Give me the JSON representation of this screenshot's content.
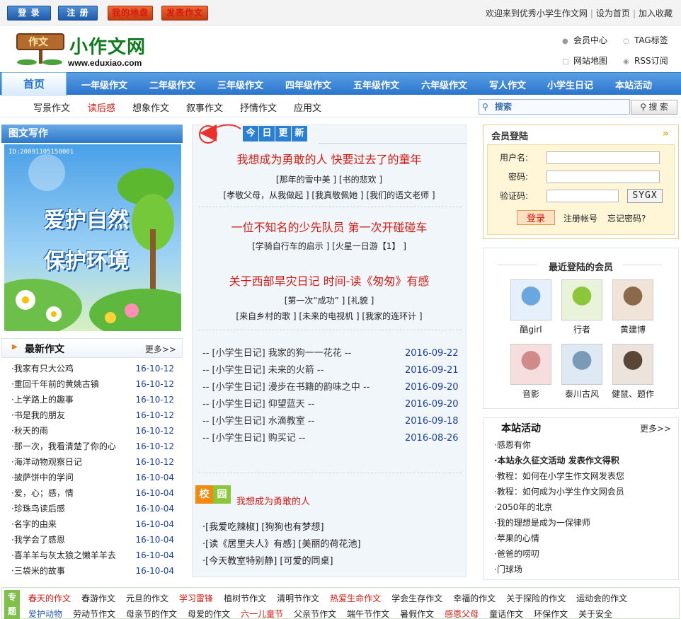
{
  "top": {
    "login": "登 录",
    "register": "注 册",
    "my_disk": "我的地盘",
    "post_essay": "发表作文",
    "welcome": "欢迎来到优秀小学生作文网",
    "set_home": "设为首页",
    "add_fav": "加入收藏"
  },
  "header": {
    "sign": "作文",
    "site_name": "小作文网",
    "url": "www.eduxiao.com",
    "links": [
      "会员中心",
      "TAG标签",
      "网站地图",
      "RSS订阅"
    ]
  },
  "nav": {
    "home": "首页",
    "items": [
      "一年级作文",
      "二年级作文",
      "三年级作文",
      "四年级作文",
      "五年级作文",
      "六年级作文",
      "写人作文",
      "小学生日记",
      "本站活动"
    ]
  },
  "subnav": [
    "写景作文",
    "读后感",
    "想象作文",
    "叙事作文",
    "抒情作文",
    "应用文"
  ],
  "search": {
    "placeholder": "搜索",
    "button": "搜 索"
  },
  "left": {
    "pic_title": "图文写作",
    "pic_caption_1": "爱护自然",
    "pic_caption_2": "保护环境",
    "pic_code": "ID:20091105150001",
    "news_title": "最新作文",
    "more": "更多>>",
    "news": [
      {
        "t": "我家有只大公鸡",
        "d": "16-10-12"
      },
      {
        "t": "重回千年前的黄姚古镇",
        "d": "16-10-12"
      },
      {
        "t": "上学路上的趣事",
        "d": "16-10-12"
      },
      {
        "t": "书是我的朋友",
        "d": "16-10-12"
      },
      {
        "t": "秋天的雨",
        "d": "16-10-12"
      },
      {
        "t": "那一次，我看清楚了你的心",
        "d": "16-10-12"
      },
      {
        "t": "海洋动物观察日记",
        "d": "16-10-12"
      },
      {
        "t": "披萨饼中的学问",
        "d": "16-10-04"
      },
      {
        "t": "爱，心；感，情",
        "d": "16-10-04"
      },
      {
        "t": "珍珠鸟读后感",
        "d": "16-10-04"
      },
      {
        "t": "名字的由来",
        "d": "16-10-04"
      },
      {
        "t": "我学会了感恩",
        "d": "16-10-04"
      },
      {
        "t": "喜羊羊与灰太狼之懒羊羊去",
        "d": "16-10-04"
      },
      {
        "t": "三袋米的故事",
        "d": "16-10-04"
      }
    ]
  },
  "mid": {
    "tab": [
      "今",
      "日",
      "更",
      "新"
    ],
    "blocks": [
      {
        "title": "我想成为勇敢的人  快要过去了的童年",
        "lines": [
          "[那年的雪中美  ] [书的悲欢  ]",
          "[孝敬父母，从我做起  ] [我真敬佩她  ] [我们的语文老师  ]"
        ]
      },
      {
        "title": "一位不知名的少先队员  第一次开碰碰车",
        "lines": [
          "[学骑自行车的启示  ] [火星一日游【1】  ]"
        ]
      },
      {
        "title": "关于西部旱灾日记  时间-读《匆匆》有感",
        "lines": [
          "[第一次“成功”  ] [礼貌  ]",
          "[来自乡村的歌  ] [未来的电视机  ] [我家的连环计  ]"
        ]
      }
    ],
    "diary": [
      {
        "t": "-- [小学生日记] 我家的狗一一花花  --",
        "d": "2016-09-22"
      },
      {
        "t": "-- [小学生日记] 未来的火箭  --",
        "d": "2016-09-21"
      },
      {
        "t": "-- [小学生日记] 漫步在书籍的韵味之中  --",
        "d": "2016-09-20"
      },
      {
        "t": "-- [小学生日记] 仰望蓝天  --",
        "d": "2016-09-20"
      },
      {
        "t": "-- [小学生日记] 水滴教室  --",
        "d": "2016-09-18"
      },
      {
        "t": "-- [小学生日记] 购买记  --",
        "d": "2016-08-26"
      }
    ],
    "campus_tag": [
      "校",
      "园"
    ],
    "campus_title": "我想成为勇敢的人",
    "campus_lines": [
      "·[我爱吃辣椒] [狗狗也有梦想]",
      "·[读《居里夫人》有感] [美丽的荷花池]",
      "·[今天教室特别静] [可爱的同桌]"
    ]
  },
  "login_box": {
    "title": "会员登陆",
    "username": "用户名:",
    "password": "密码:",
    "captcha": "验证码:",
    "captcha_code": "SYGX",
    "login_btn": "登录",
    "register": "注册帐号",
    "forgot": "忘记密码?"
  },
  "members": {
    "title": "最近登陆的会员",
    "list": [
      "酷girl",
      "行者",
      "黄建博",
      "音影",
      "泰川古风",
      "健鼠、题作"
    ]
  },
  "activity": {
    "title": "本站活动",
    "more": "更多>>",
    "items": [
      "·感恩有你",
      "·本站永久征文活动 发表作文得积",
      "·教程：如何在小学生作文网发表您",
      "·教程：如何成为小学生作文网会员",
      "·2050年的北京",
      "·我的理想是成为一保律师",
      "·苹果的心情",
      "·爸爸的唠叨",
      "·门球场"
    ]
  },
  "topics": {
    "tag": [
      "专",
      "题"
    ],
    "row1": [
      {
        "t": "春天的作文",
        "red": true
      },
      {
        "t": "春游作文"
      },
      {
        "t": "元旦的作文"
      },
      {
        "t": "学习雷锋",
        "red": true
      },
      {
        "t": "植树节作文"
      },
      {
        "t": "清明节作文"
      },
      {
        "t": "热爱生命作文",
        "red": true
      },
      {
        "t": "学会生存作文"
      },
      {
        "t": "幸福的作文"
      },
      {
        "t": "关于探险的作文"
      },
      {
        "t": "运动会的作文"
      }
    ],
    "row2": [
      {
        "t": "爱护动物",
        "blue": true
      },
      {
        "t": "劳动节作文"
      },
      {
        "t": "母亲节的作文"
      },
      {
        "t": "母爱的作文"
      },
      {
        "t": "六一儿童节",
        "red": true
      },
      {
        "t": "父亲节作文"
      },
      {
        "t": "端午节作文"
      },
      {
        "t": "暑假作文"
      },
      {
        "t": "感恩父母",
        "red": true
      },
      {
        "t": "童话作文"
      },
      {
        "t": "环保作文"
      },
      {
        "t": "关于安全"
      }
    ]
  }
}
